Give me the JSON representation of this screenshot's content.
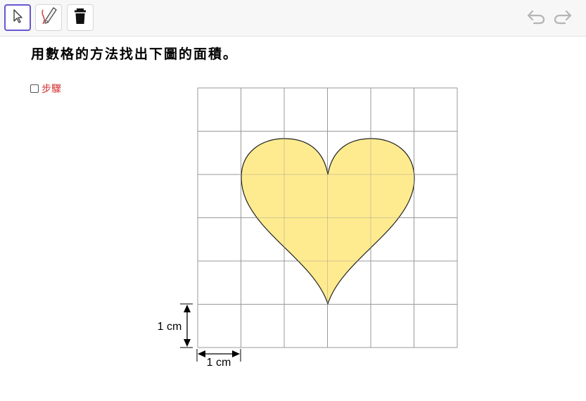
{
  "toolbar": {
    "tools": [
      {
        "icon": "arrow-pointer-icon",
        "active": true
      },
      {
        "icon": "pen-icon",
        "active": false
      },
      {
        "icon": "trash-icon",
        "active": false
      }
    ],
    "undo_icon": "undo-icon",
    "redo_icon": "redo-icon"
  },
  "question": {
    "text": "用數格的方法找出下圖的面積。"
  },
  "steps": {
    "label": "步驟",
    "checked": false,
    "color": "#d32f2f"
  },
  "figure": {
    "grid_columns": 6,
    "grid_rows": 6,
    "heart_fill": "#ffeb8f",
    "heart_stroke": "#222222",
    "grid_color": "#9a9a9a",
    "vertical_measure_label": "1 cm",
    "horizontal_measure_label": "1 cm"
  }
}
